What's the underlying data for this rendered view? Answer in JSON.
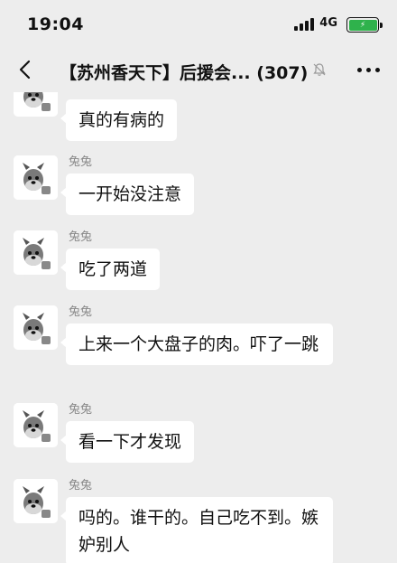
{
  "status": {
    "time": "19:04",
    "network": "4G"
  },
  "header": {
    "back_icon": "chevron-left-icon",
    "title": "【苏州香天下】后援会... (307)",
    "mute_icon": "bell-muted-icon",
    "more_icon": "more-dots-icon"
  },
  "colors": {
    "background": "#ededed",
    "bubble": "#ffffff",
    "sender_name": "#888888",
    "battery_fill": "#2fb24c"
  },
  "messages": [
    {
      "sender": "",
      "text": "真的有病的"
    },
    {
      "sender": "兔兔",
      "text": "一开始没注意"
    },
    {
      "sender": "兔兔",
      "text": "吃了两道"
    },
    {
      "sender": "兔兔",
      "text": "上来一个大盘子的肉。吓了一跳"
    },
    {
      "sender": "兔兔",
      "text": "看一下才发现"
    },
    {
      "sender": "兔兔",
      "text": "吗的。谁干的。自己吃不到。嫉妒别人"
    }
  ]
}
